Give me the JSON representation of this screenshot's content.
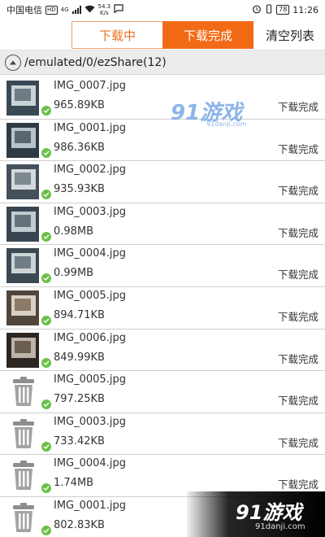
{
  "status_bar": {
    "carrier": "中国电信",
    "hd": "HD",
    "net": "4G",
    "speed": "54.3",
    "speed_unit": "K/s",
    "battery": "78",
    "time": "11:26"
  },
  "tabs": {
    "downloading": "下载中",
    "done": "下载完成",
    "clear": "清空列表"
  },
  "path": "/emulated/0/ezShare(12)",
  "files": [
    {
      "name": "IMG_0007.jpg",
      "size": "965.89KB",
      "status": "下载完成",
      "thumb": "photo"
    },
    {
      "name": "IMG_0001.jpg",
      "size": "986.36KB",
      "status": "下载完成",
      "thumb": "photo"
    },
    {
      "name": "IMG_0002.jpg",
      "size": "935.93KB",
      "status": "下载完成",
      "thumb": "photo"
    },
    {
      "name": "IMG_0003.jpg",
      "size": "0.98MB",
      "status": "下载完成",
      "thumb": "photo"
    },
    {
      "name": "IMG_0004.jpg",
      "size": "0.99MB",
      "status": "下载完成",
      "thumb": "photo"
    },
    {
      "name": "IMG_0005.jpg",
      "size": "894.71KB",
      "status": "下载完成",
      "thumb": "photo"
    },
    {
      "name": "IMG_0006.jpg",
      "size": "849.99KB",
      "status": "下载完成",
      "thumb": "photo"
    },
    {
      "name": "IMG_0005.jpg",
      "size": "797.25KB",
      "status": "下载完成",
      "thumb": "trash"
    },
    {
      "name": "IMG_0003.jpg",
      "size": "733.42KB",
      "status": "下载完成",
      "thumb": "trash"
    },
    {
      "name": "IMG_0004.jpg",
      "size": "1.74MB",
      "status": "下载完成",
      "thumb": "trash"
    },
    {
      "name": "IMG_0001.jpg",
      "size": "802.83KB",
      "status": "下载完成",
      "thumb": "trash"
    }
  ],
  "watermark": {
    "logo": "91游戏",
    "site": "91danji.com"
  },
  "colors": {
    "accent": "#f26a16",
    "check": "#6cc04a"
  }
}
